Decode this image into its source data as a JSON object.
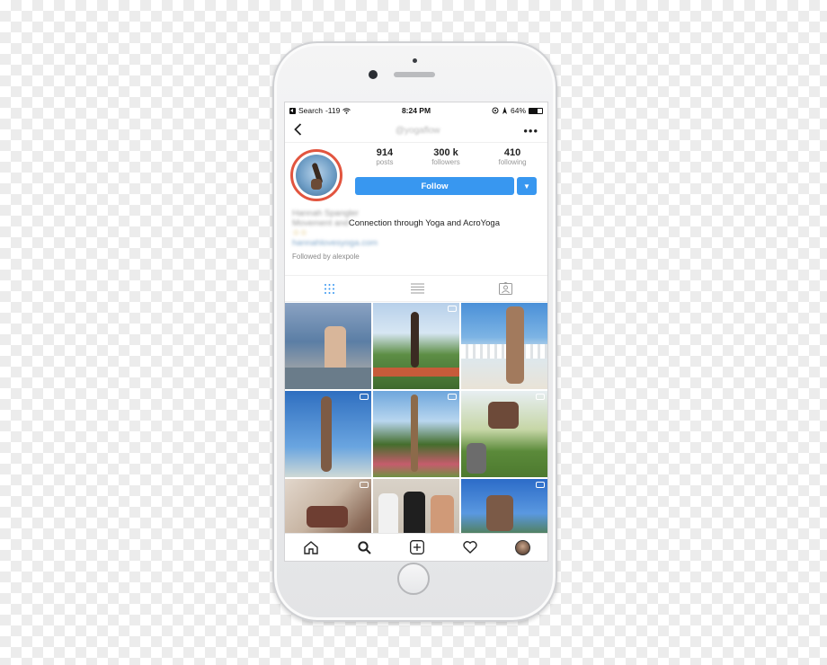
{
  "status_bar": {
    "back_app": "Search",
    "signal": "-119",
    "time": "8:24 PM",
    "battery": "64%",
    "battery_level": 0.64
  },
  "header": {
    "username": "@yogaflow",
    "back_icon": "chevron-left-icon",
    "more_icon": "more-dots-icon"
  },
  "profile": {
    "stats": [
      {
        "num": "914",
        "label": "posts"
      },
      {
        "num": "300 k",
        "label": "followers"
      },
      {
        "num": "410",
        "label": "following"
      }
    ],
    "follow_label": "Follow",
    "follow_dropdown_icon": "triangle-down-icon",
    "bio_name": "Hannah Spangler",
    "bio_blurred_prefix": "Movement and",
    "bio_text": "Connection through Yoga and AcroYoga",
    "bio_extra": "☆☆",
    "bio_link": "hannahlovesyoga.com",
    "followed_by": "Followed by alexpole"
  },
  "tabs": [
    {
      "icon": "grid-icon",
      "active": true
    },
    {
      "icon": "list-icon",
      "active": false
    },
    {
      "icon": "tagged-icon",
      "active": false
    }
  ],
  "grid_posts": [
    {
      "kind": "photo",
      "scene": "rock-beach"
    },
    {
      "kind": "video",
      "scene": "garden-acro"
    },
    {
      "kind": "photo",
      "scene": "beach-fence"
    },
    {
      "kind": "video",
      "scene": "sky-handstand"
    },
    {
      "kind": "photo",
      "scene": "garden-stack"
    },
    {
      "kind": "video",
      "scene": "park-acro"
    },
    {
      "kind": "video",
      "scene": "indoor-acro"
    },
    {
      "kind": "photo",
      "scene": "three-friends"
    },
    {
      "kind": "video",
      "scene": "sky-trees"
    }
  ],
  "bottom_nav": [
    {
      "icon": "home-icon"
    },
    {
      "icon": "search-icon"
    },
    {
      "icon": "add-post-icon"
    },
    {
      "icon": "heart-icon"
    },
    {
      "icon": "profile-avatar-icon"
    }
  ]
}
